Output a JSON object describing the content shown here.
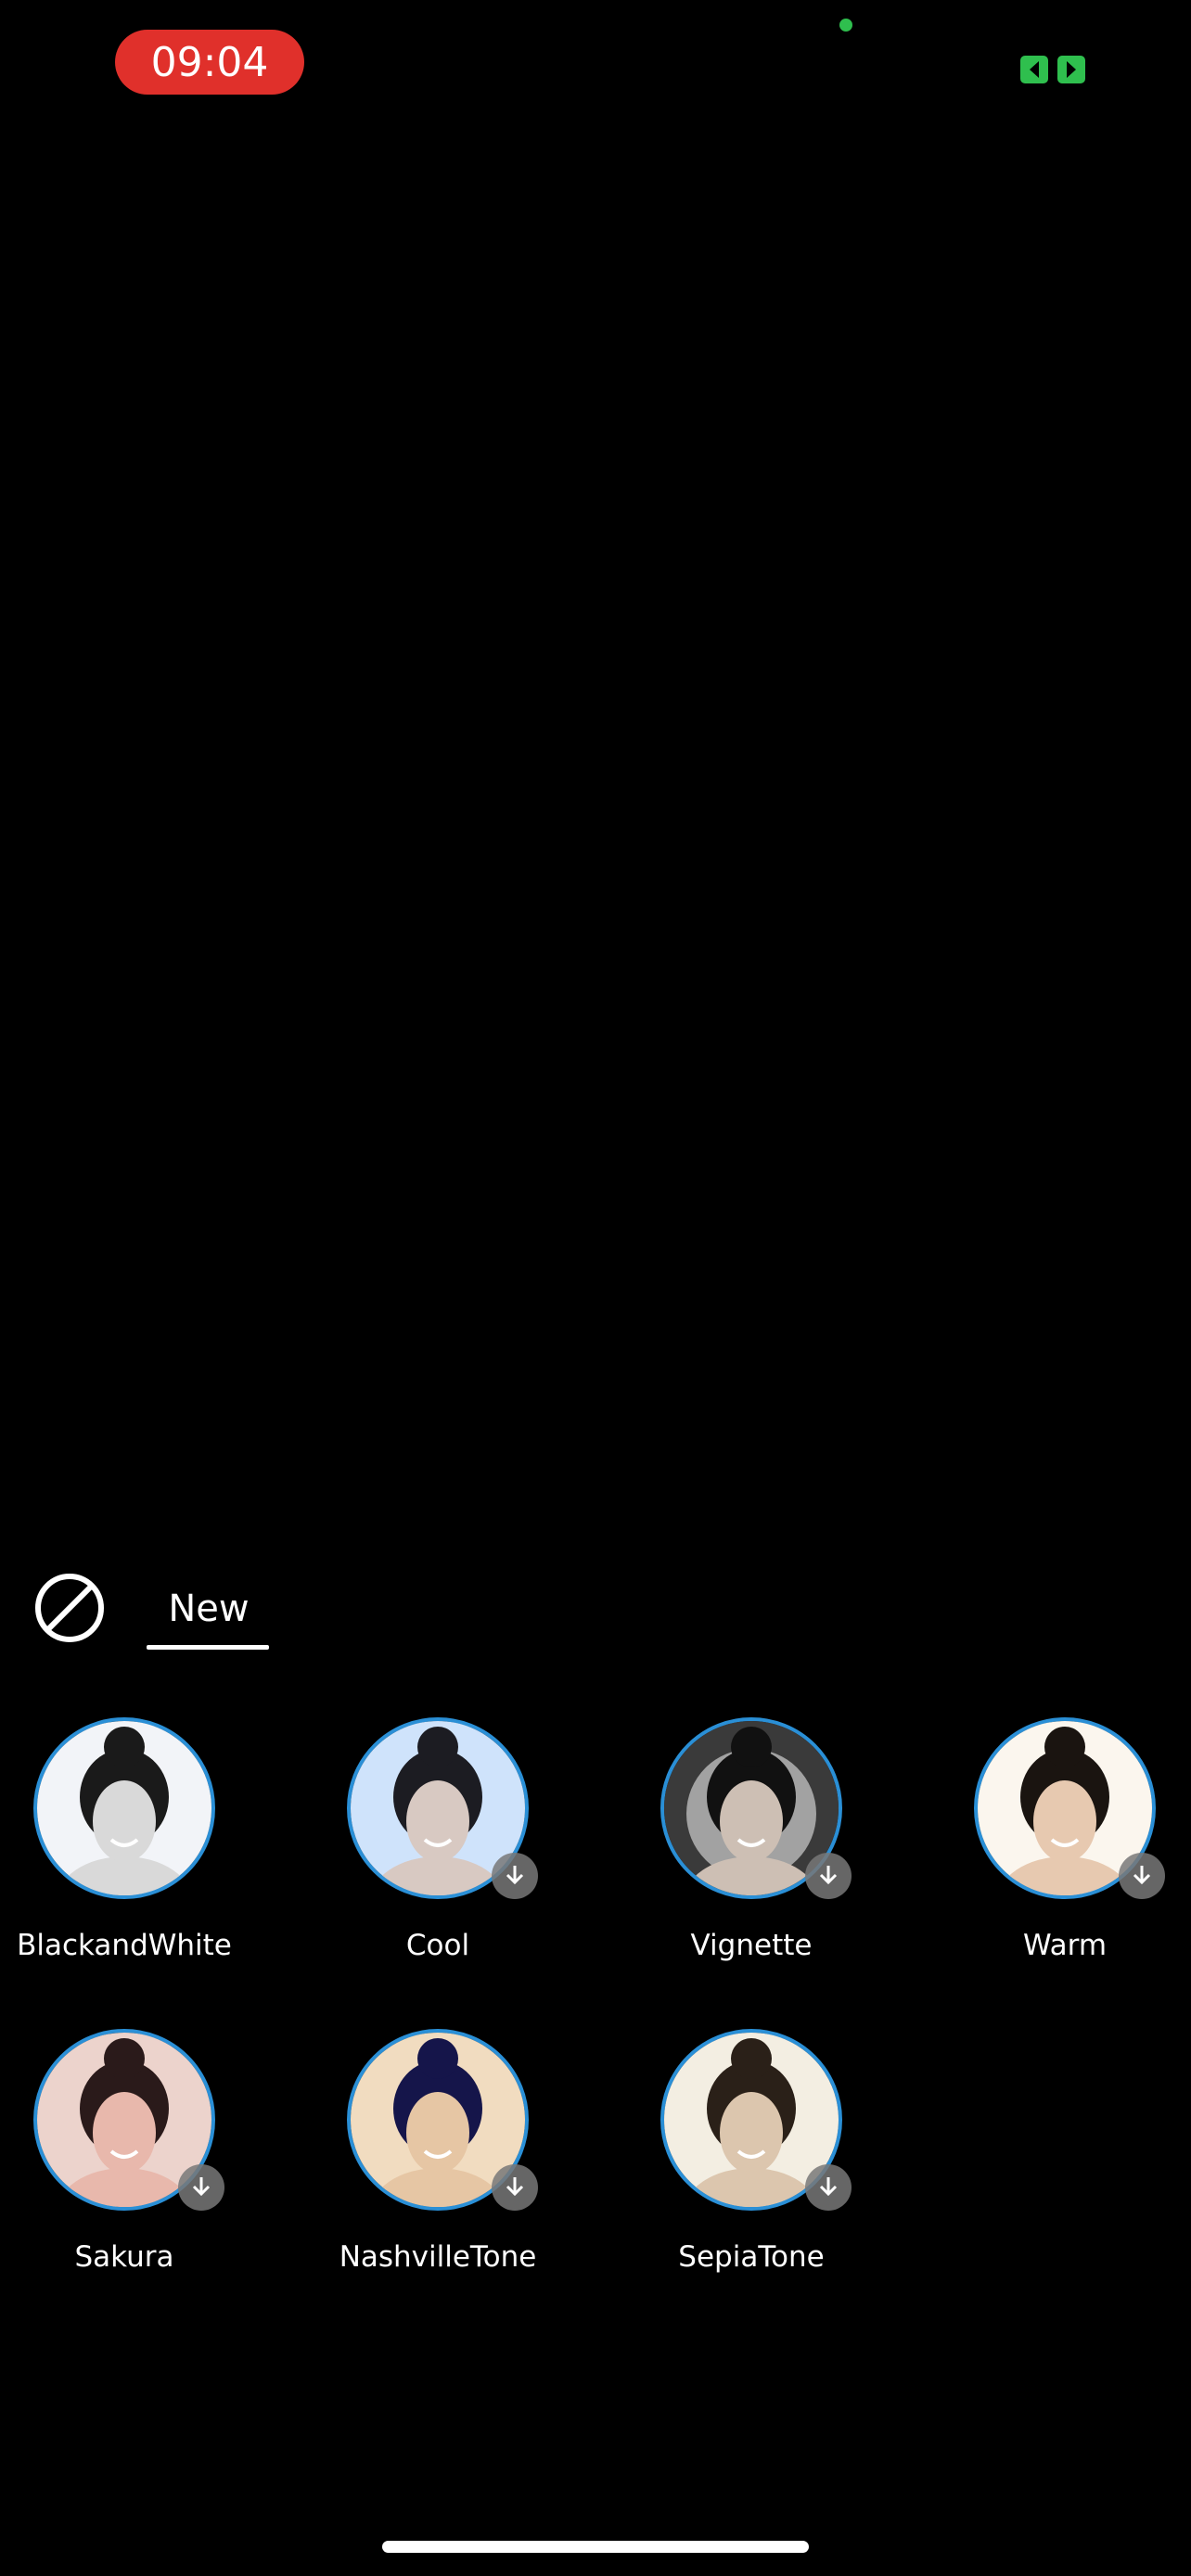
{
  "status_bar": {
    "time": "09:04",
    "time_pill_color": "#e0302b",
    "camera_indicator_color": "#2fbf4e",
    "cast_icon": "screen-mirroring-icon"
  },
  "filter_panel": {
    "none_icon": "no-filter-icon",
    "active_tab": "New",
    "tabs": [
      {
        "label": "New"
      }
    ],
    "filters": [
      {
        "label": "BlackandWhite",
        "tint": "#f2f4f8",
        "hair": "#1a1a1a",
        "skin": "#d9d9d9",
        "download": false
      },
      {
        "label": "Cool",
        "tint": "#cfe3fb",
        "hair": "#1c1c22",
        "skin": "#d8c9c2",
        "download": true
      },
      {
        "label": "Vignette",
        "tint": "#3a3a3a",
        "hair": "#111",
        "skin": "#cdbfb4",
        "download": true
      },
      {
        "label": "Warm",
        "tint": "#fbf6ee",
        "hair": "#1a1410",
        "skin": "#e7c9b0",
        "download": true
      },
      {
        "label": "Sakura",
        "tint": "#ecd3cc",
        "hair": "#2a1a1a",
        "skin": "#e8b8ac",
        "download": true
      },
      {
        "label": "NashvilleTone",
        "tint": "#f1dcc0",
        "hair": "#15154a",
        "skin": "#e6c6a4",
        "download": true
      },
      {
        "label": "SepiaTone",
        "tint": "#f3eee2",
        "hair": "#2a2018",
        "skin": "#dcc6ae",
        "download": true
      }
    ]
  }
}
